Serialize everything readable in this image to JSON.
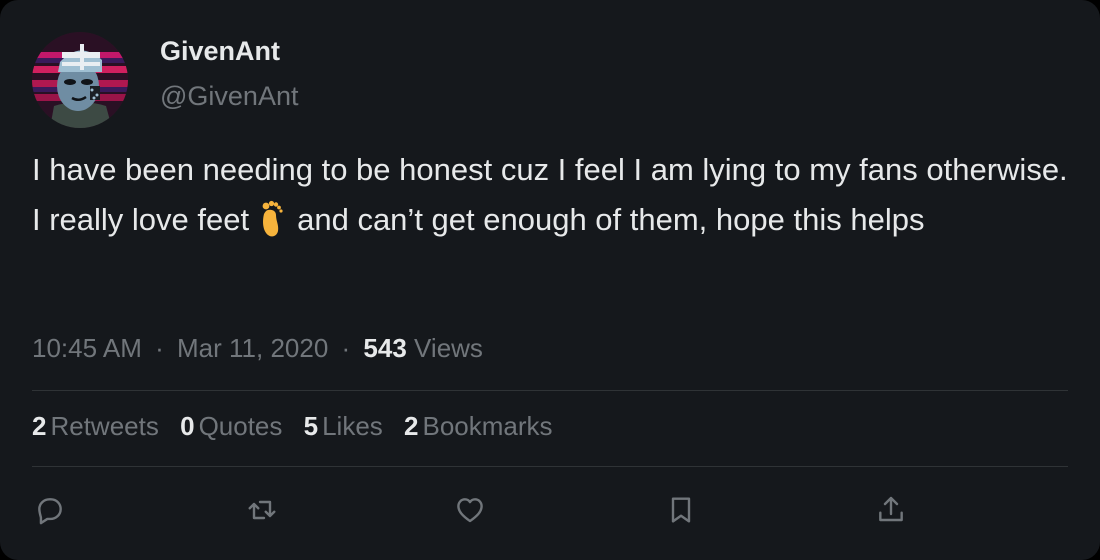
{
  "user": {
    "display_name": "GivenAnt",
    "handle": "@GivenAnt",
    "avatar_icon": "avatar-illustration"
  },
  "tweet": {
    "text_part1": "I have been needing to be honest cuz I feel I am lying to my fans otherwise. I really love feet",
    "emoji_icon": "foot-emoji",
    "text_part2": "and can’t get enough of them, hope this helps"
  },
  "meta": {
    "time": "10:45 AM",
    "separator": "·",
    "date": "Mar 11, 2020",
    "separator2": "·",
    "views_count": "543",
    "views_label": "Views"
  },
  "stats": [
    {
      "count": "2",
      "label": "Retweets"
    },
    {
      "count": "0",
      "label": "Quotes"
    },
    {
      "count": "5",
      "label": "Likes"
    },
    {
      "count": "2",
      "label": "Bookmarks"
    }
  ],
  "actions": {
    "reply_icon": "reply-icon",
    "retweet_icon": "retweet-icon",
    "like_icon": "heart-icon",
    "bookmark_icon": "bookmark-icon",
    "share_icon": "share-icon"
  },
  "colors": {
    "background": "#15181c",
    "primary_text": "#e7e9ea",
    "secondary_text": "#71767b",
    "divider": "#2f3336"
  }
}
